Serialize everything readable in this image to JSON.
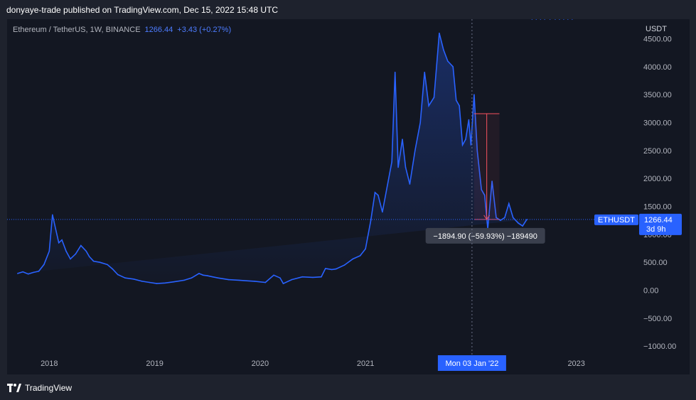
{
  "header": {
    "published": "donyaye-trade published on TradingView.com, Dec 15, 2022 15:48 UTC"
  },
  "legend": {
    "symbol": "Ethereum / TetherUS, 1W, BINANCE",
    "price": "1266.44",
    "change": "+3.43 (+0.27%)"
  },
  "footer": {
    "brand": "TradingView"
  },
  "colors": {
    "line": "#2962ff",
    "measure": "#f7525f",
    "background": "#131722",
    "accent": "#2962ff"
  },
  "chart_data": {
    "type": "area",
    "title": "",
    "currency": "USDT",
    "x": [
      2017.7,
      2017.75,
      2017.8,
      2017.85,
      2017.9,
      2017.95,
      2018.0,
      2018.03,
      2018.06,
      2018.09,
      2018.12,
      2018.16,
      2018.2,
      2018.25,
      2018.3,
      2018.35,
      2018.38,
      2018.42,
      2018.48,
      2018.55,
      2018.6,
      2018.65,
      2018.72,
      2018.8,
      2018.88,
      2018.95,
      2019.02,
      2019.1,
      2019.18,
      2019.28,
      2019.35,
      2019.42,
      2019.46,
      2019.5,
      2019.55,
      2019.6,
      2019.7,
      2019.8,
      2019.87,
      2019.95,
      2020.05,
      2020.13,
      2020.19,
      2020.22,
      2020.3,
      2020.4,
      2020.5,
      2020.58,
      2020.62,
      2020.68,
      2020.72,
      2020.8,
      2020.88,
      2020.95,
      2021.0,
      2021.05,
      2021.09,
      2021.12,
      2021.16,
      2021.2,
      2021.25,
      2021.28,
      2021.31,
      2021.35,
      2021.38,
      2021.42,
      2021.47,
      2021.52,
      2021.56,
      2021.6,
      2021.65,
      2021.7,
      2021.74,
      2021.78,
      2021.83,
      2021.86,
      2021.89,
      2021.92,
      2021.95,
      2021.98,
      2022.0,
      2022.03,
      2022.06,
      2022.1,
      2022.13,
      2022.16,
      2022.2,
      2022.24,
      2022.28,
      2022.32,
      2022.36,
      2022.4,
      2022.45,
      2022.49,
      2022.53,
      2022.58,
      2022.62,
      2022.66,
      2022.7,
      2022.75,
      2022.8,
      2022.84,
      2022.88,
      2022.92,
      2022.96
    ],
    "y": [
      300,
      330,
      290,
      320,
      340,
      460,
      700,
      1350,
      1100,
      850,
      900,
      700,
      560,
      650,
      800,
      700,
      600,
      520,
      500,
      460,
      380,
      280,
      220,
      200,
      160,
      140,
      120,
      130,
      150,
      180,
      220,
      300,
      270,
      260,
      240,
      220,
      190,
      180,
      170,
      160,
      140,
      270,
      220,
      120,
      190,
      240,
      230,
      240,
      390,
      370,
      380,
      450,
      560,
      620,
      740,
      1250,
      1750,
      1700,
      1400,
      1800,
      2300,
      3900,
      2200,
      2700,
      2200,
      1900,
      2500,
      3000,
      3900,
      3300,
      3450,
      4600,
      4300,
      4100,
      4000,
      3400,
      3300,
      2600,
      2700,
      3050,
      2600,
      3500,
      2500,
      1800,
      1700,
      1100,
      1950,
      1300,
      1250,
      1300,
      1550,
      1300,
      1200,
      1150,
      1266.44
    ],
    "x_ticks": [
      "2018",
      "2019",
      "2020",
      "2021",
      "2022",
      "2023"
    ],
    "x_tick_values": [
      2018.0,
      2019.0,
      2020.0,
      2021.0,
      2022.0,
      2023.0
    ],
    "y_ticks": [
      -1000,
      -500,
      0,
      500,
      1000,
      1500,
      2000,
      2500,
      3000,
      3500,
      4000,
      4500
    ],
    "y_tick_labels": [
      "−1000.00",
      "−500.00",
      "0.00",
      "500.00",
      "1000.00",
      "1500.00",
      "2000.00",
      "2500.00",
      "3000.00",
      "3500.00",
      "4000.00",
      "4500.00"
    ],
    "ylim": [
      -1150,
      4850
    ],
    "xlim": [
      2017.6,
      2023.4
    ],
    "last_price": {
      "symbol": "ETHUSDT",
      "value": 1266.44,
      "label": "1266.44",
      "countdown": "3d 9h"
    },
    "crosshair": {
      "x": 2022.01,
      "label": "Mon 03 Jan '22"
    },
    "measure": {
      "x": 2022.15,
      "from": 3160,
      "to": 1266.44,
      "label": "−1894.90 (−59.93%) −189490"
    },
    "grid": false
  }
}
